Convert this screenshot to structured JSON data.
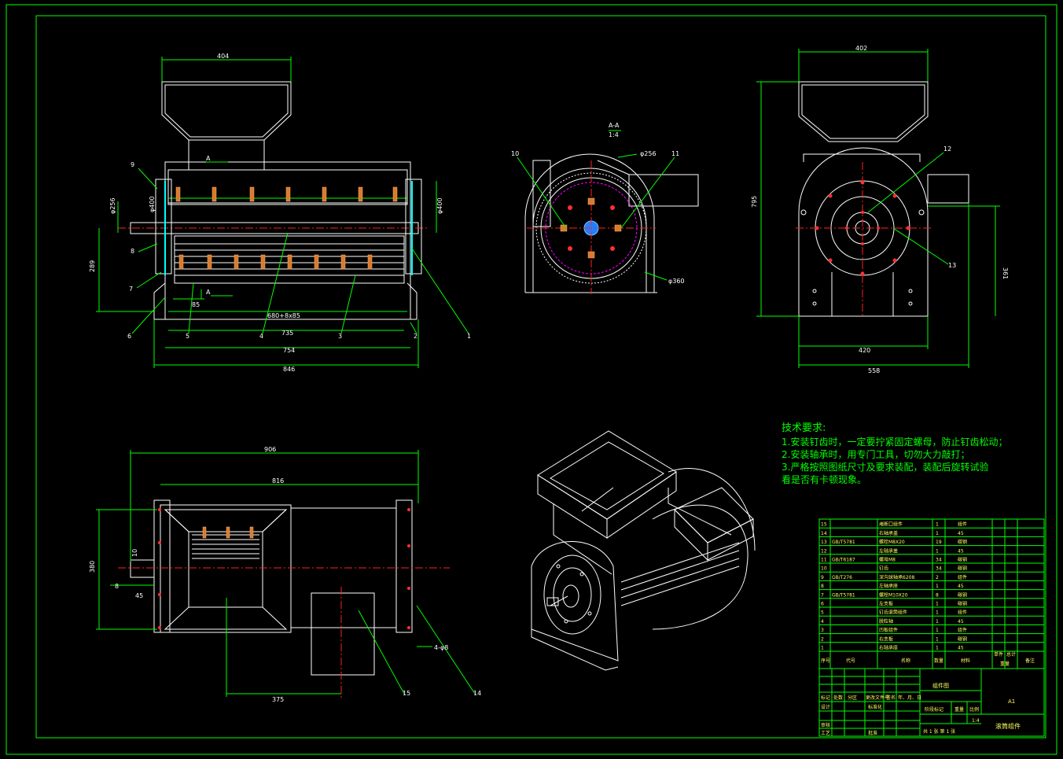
{
  "view_label": "A-A",
  "view_scale": "1:4",
  "section_label": "A",
  "dimensions": {
    "front": {
      "hopper_width": "404",
      "d1": "φ256",
      "d2": "φ400",
      "d3": "φ400 ",
      "height_left": "289",
      "d85": "85",
      "shaft_dims": "680+8x85",
      "d735": "735",
      "d754": "754",
      "d846": "846"
    },
    "section": {
      "d256": "φ256",
      "d360": "φ360"
    },
    "side": {
      "top": "402",
      "height": "795",
      "right": "361",
      "base1": "420",
      "base2": "558"
    },
    "top": {
      "overall": "906",
      "inner": "816",
      "height": "380",
      "d10": "10",
      "d8": "8",
      "d45": "45",
      "d375": "375",
      "holes": "4-φ8"
    }
  },
  "callouts": [
    "1",
    "2",
    "3",
    "4",
    "5",
    "6",
    "7",
    "8",
    "9",
    "10",
    "11",
    "12",
    "13",
    "14",
    "15"
  ],
  "tech_requirements": {
    "title": "技术要求:",
    "lines": [
      "1.安装钉齿时，一定要拧紧固定螺母，防止钉齿松动；",
      "2.安装轴承时，用专门工具，切勿大力敲打；",
      "3.严格按照图纸尺寸及要求装配，装配后旋转试验",
      "看是否有卡顿现象。"
    ]
  },
  "parts_list": {
    "rows": [
      {
        "no": "15",
        "code": "",
        "name": "堵断口组件",
        "qty": "1",
        "material": "组件"
      },
      {
        "no": "14",
        "code": "",
        "name": "右轴承盖",
        "qty": "1",
        "material": "45"
      },
      {
        "no": "13",
        "code": "GB/T5781",
        "name": "螺栓M8X20",
        "qty": "19",
        "material": "碳钢"
      },
      {
        "no": "12",
        "code": "",
        "name": "左轴承盖",
        "qty": "1",
        "material": "45"
      },
      {
        "no": "11",
        "code": "GB/T6187",
        "name": "螺母M8",
        "qty": "34",
        "material": "碳钢"
      },
      {
        "no": "10",
        "code": "",
        "name": "钉齿",
        "qty": "34",
        "material": "碳钢"
      },
      {
        "no": "9",
        "code": "GB/T276",
        "name": "深沟球轴承6208",
        "qty": "2",
        "material": "组件"
      },
      {
        "no": "8",
        "code": "",
        "name": "左轴承座",
        "qty": "1",
        "material": "45"
      },
      {
        "no": "7",
        "code": "GB/T5781",
        "name": "螺栓M10X20",
        "qty": "8",
        "material": "碳钢"
      },
      {
        "no": "6",
        "code": "",
        "name": "左支板",
        "qty": "1",
        "material": "碳钢"
      },
      {
        "no": "5",
        "code": "",
        "name": "钉齿滚筒组件",
        "qty": "1",
        "material": "组件"
      },
      {
        "no": "4",
        "code": "",
        "name": "脱粒轴",
        "qty": "1",
        "material": "45"
      },
      {
        "no": "3",
        "code": "",
        "name": "凹板组件",
        "qty": "1",
        "material": "组件"
      },
      {
        "no": "2",
        "code": "",
        "name": "右支板",
        "qty": "1",
        "material": "碳钢"
      },
      {
        "no": "1",
        "code": "",
        "name": "右轴承座",
        "qty": "1",
        "material": "45"
      }
    ],
    "headers": {
      "no": "序号",
      "code": "代号",
      "name": "名称",
      "qty": "数量",
      "material": "材料",
      "unit_wt": "单件",
      "total_wt": "总计",
      "weight": "重量",
      "remark": "备注"
    }
  },
  "title_block": {
    "drawing_name": "滚筒组件",
    "drawing_type": "组件图",
    "sheet_size": "A1",
    "scale_value": "1:4",
    "labels": {
      "mark": "标记",
      "count": "处数",
      "zone": "分区",
      "change_no": "更改文件号",
      "sign": "签名",
      "date": "年、月、日",
      "design": "设计",
      "standard": "标准化",
      "stage_mark": "阶段标记",
      "weight": "重量",
      "scale": "比例",
      "review": "审核",
      "process": "工艺",
      "approve": "批准",
      "sheet": "共 1 张  第 1 张"
    }
  }
}
